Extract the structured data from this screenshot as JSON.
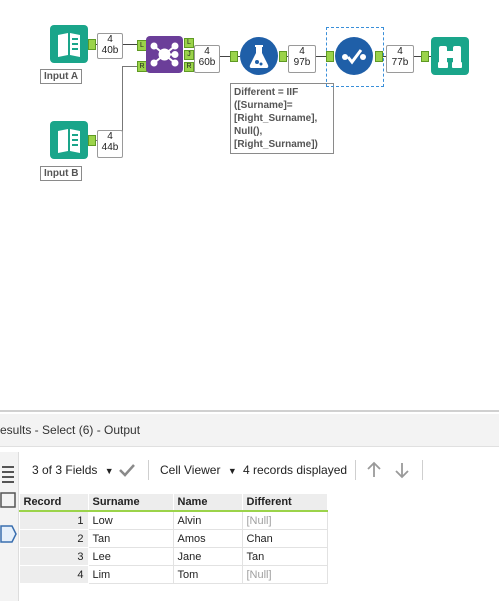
{
  "workflow": {
    "input_a_label": "Input A",
    "input_b_label": "Input B",
    "conn_a": {
      "count": "4",
      "size": "40b"
    },
    "conn_b": {
      "count": "4",
      "size": "44b"
    },
    "conn_join": {
      "count": "4",
      "size": "60b"
    },
    "conn_formula": {
      "count": "4",
      "size": "97b"
    },
    "conn_select": {
      "count": "4",
      "size": "77b"
    },
    "join_anchor_left": "L",
    "join_anchor_right": "R",
    "join_anchor_out_l": "L",
    "join_anchor_out_j": "J",
    "join_anchor_out_r": "R",
    "formula_lines": [
      "Different = IIF",
      "([Surname]=",
      "[Right_Surname],",
      "Null(),",
      "[Right_Surname])"
    ]
  },
  "results": {
    "title": "esults - Select (6) - Output",
    "fields_label": "3 of 3 Fields",
    "cell_viewer_label": "Cell Viewer",
    "records_displayed": "4 records displayed",
    "columns": [
      "Record",
      "Surname",
      "Name",
      "Different"
    ],
    "rows": [
      {
        "record": "1",
        "surname": "Low",
        "name": "Alvin",
        "different": "[Null]"
      },
      {
        "record": "2",
        "surname": "Tan",
        "name": "Amos",
        "different": "Chan"
      },
      {
        "record": "3",
        "surname": "Lee",
        "name": "Jane",
        "different": "Tan"
      },
      {
        "record": "4",
        "surname": "Lim",
        "name": "Tom",
        "different": "[Null]"
      }
    ]
  },
  "colors": {
    "input_tool": "#1aa58a",
    "join_tool": "#6b3e99",
    "formula_tool": "#1f5fa8",
    "select_tool": "#1f5fa8",
    "browse_tool": "#1aa58a",
    "anchor": "#9bd34a"
  },
  "icons": [
    "book-icon",
    "join-icon",
    "flask-icon",
    "checkmark-circle-icon",
    "binoculars-icon",
    "fields-check-icon",
    "dropdown-icon",
    "arrow-up-icon",
    "arrow-down-icon"
  ]
}
